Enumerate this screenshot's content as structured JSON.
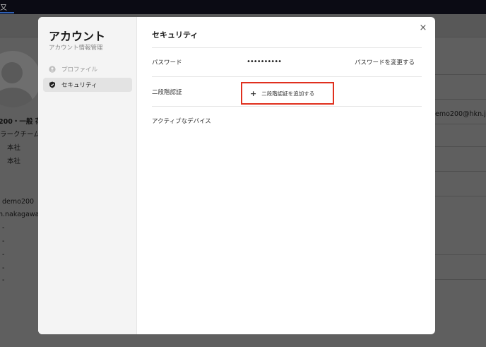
{
  "topbar": {
    "glyph": "又"
  },
  "background": {
    "name_line": "200・一般 花",
    "team": "ラークチーム",
    "office_1": "本社",
    "office_2": "本社",
    "email": "emo200@hkn.jp",
    "user_id": "demo200",
    "user_handle": "n.nakagawa",
    "dashes": [
      "-",
      "-",
      "-",
      "-",
      "-"
    ]
  },
  "modal": {
    "sidebar": {
      "title": "アカウント",
      "subtitle": "アカウント情報管理",
      "items": [
        {
          "label": "プロファイル",
          "icon": "user-icon",
          "active": false
        },
        {
          "label": "セキュリティ",
          "icon": "shield-icon",
          "active": true
        }
      ]
    },
    "main": {
      "title": "セキュリティ",
      "close_glyph": "×",
      "password": {
        "label": "パスワード",
        "value": "••••••••••",
        "change_label": "パスワードを変更する"
      },
      "two_factor": {
        "label": "二段階認証",
        "add_plus": "+",
        "add_label": "二段階認証を追加する",
        "highlight_color": "#e0301e"
      },
      "devices": {
        "label": "アクティブなデバイス"
      }
    }
  }
}
